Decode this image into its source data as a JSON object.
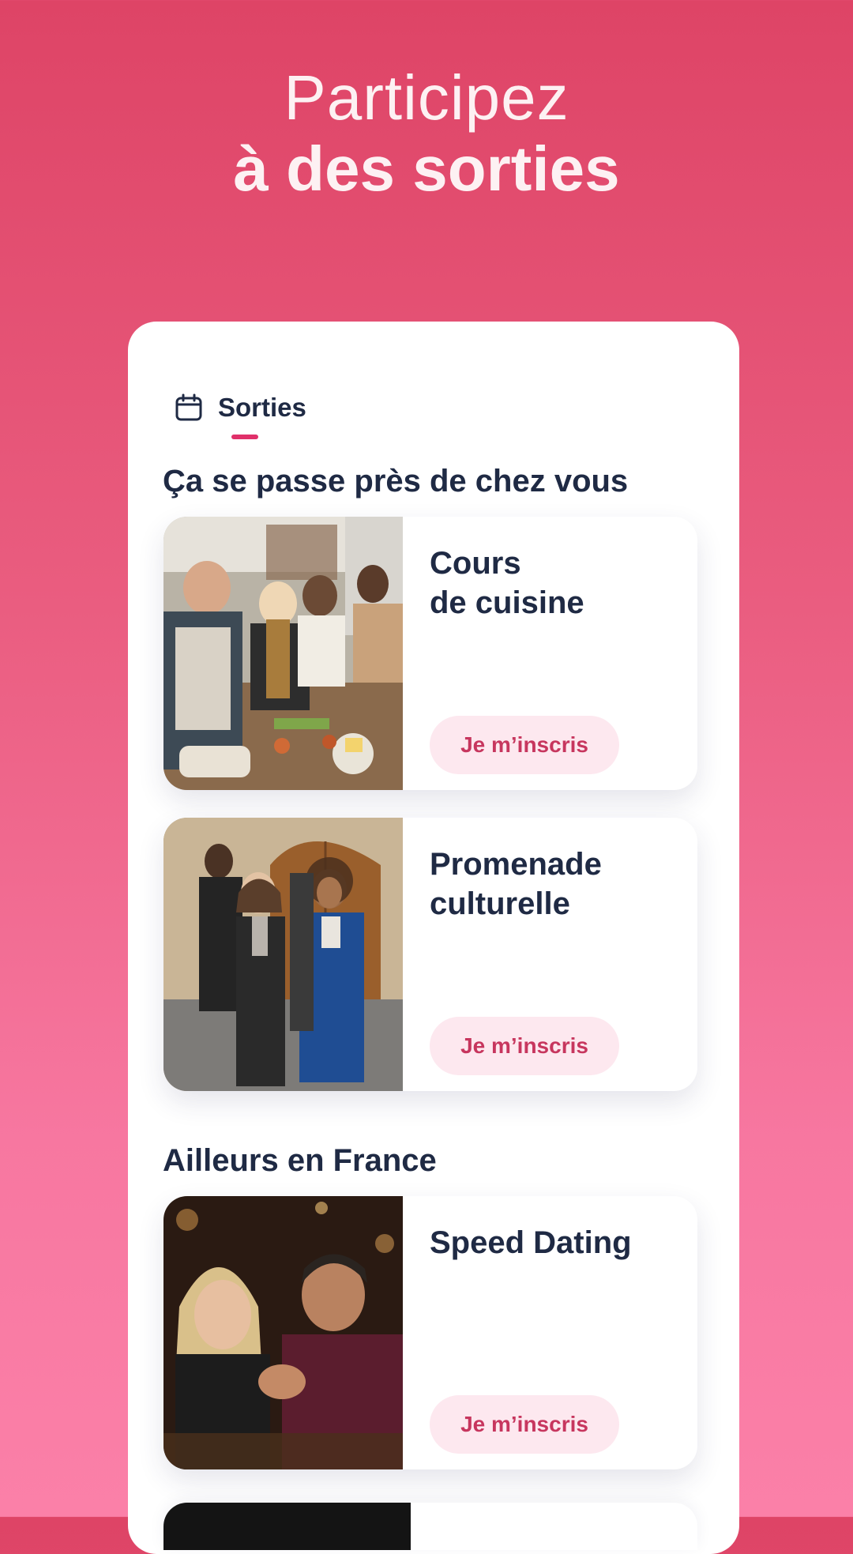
{
  "headline": {
    "line1": "Participez",
    "line2": "à des sorties"
  },
  "tab": {
    "label": "Sorties",
    "icon": "calendar-icon"
  },
  "sections": [
    {
      "title": "Ça se passe près de chez vous",
      "events": [
        {
          "title": "Cours\nde cuisine",
          "cta": "Je m’inscris",
          "photo": "cooking-class-photo"
        },
        {
          "title": "Promenade\nculturelle",
          "cta": "Je m’inscris",
          "photo": "cultural-walk-photo"
        }
      ]
    },
    {
      "title": "Ailleurs en France",
      "events": [
        {
          "title": "Speed Dating",
          "cta": "Je m’inscris",
          "photo": "speed-dating-photo"
        }
      ]
    }
  ],
  "colors": {
    "gradient_top": "#de4466",
    "gradient_bottom": "#fb80a8",
    "text_dark": "#1f2a44",
    "accent": "#e0306a",
    "button_bg": "#fde8ef",
    "button_text": "#c7365e"
  }
}
